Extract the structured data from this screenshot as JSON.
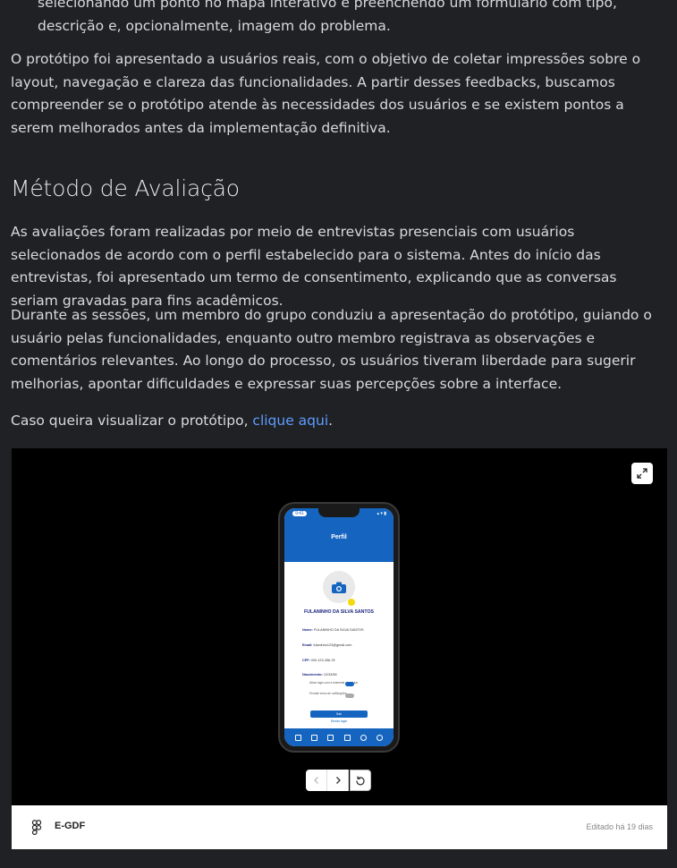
{
  "article": {
    "bullet_tail": "selecionando um ponto no mapa interativo e preenchendo um formulário com tipo, descrição e, opcionalmente, imagem do problema.",
    "para_prototype": "O protótipo foi apresentado a usuários reais, com o objetivo de coletar impressões sobre o layout, navegação e clareza das funcionalidades. A partir desses feedbacks, buscamos compreender se o protótipo atende às necessidades dos usuários e se existem pontos a serem melhorados antes da implementação definitiva.",
    "heading_method": "Método de Avaliação",
    "para_interviews": "As avaliações foram realizadas por meio de entrevistas presenciais com usuários selecionados de acordo com o perfil estabelecido para o sistema. Antes do início das entrevistas, foi apresentado um termo de consentimento, explicando que as conversas seriam gravadas para fins acadêmicos.",
    "para_sessions": "Durante as sessões, um membro do grupo conduziu a apresentação do protótipo, guiando o usuário pelas funcionalidades, enquanto outro membro registrava as observações e comentários relevantes. Ao longo do processo, os usuários tiveram liberdade para sugerir melhorias, apontar dificuldades e expressar suas percepções sobre a interface.",
    "view_prefix": "Caso queira visualizar o protótipo, ",
    "view_link": "clique aqui",
    "view_suffix": "."
  },
  "embed": {
    "file_name": "E-GDF",
    "edited": "Editado há 19 dias",
    "phone": {
      "time": "9:41",
      "status": "▴ ▾ ▮",
      "title": "Perfil",
      "name": "FULANINHO DA SILVA SANTOS",
      "fields": [
        {
          "label": "Nome:",
          "value": "FULANINHO DA SILVA SANTOS"
        },
        {
          "label": "Email:",
          "value": "fulaninho123@gmail.com"
        },
        {
          "label": "CPF:",
          "value": "000.123.456-78"
        },
        {
          "label": "Nascimento:",
          "value": "12/34/56"
        }
      ],
      "toggle1": "Ativar login com a biometria do celular",
      "toggle2": "Permitir envio de notificações",
      "logout_button": "Sair",
      "logout_link": "Deslar login"
    }
  },
  "colors": {
    "background": "#202124",
    "text": "#d7dade",
    "link": "#5c9dff",
    "phone_primary": "#1565c0"
  }
}
